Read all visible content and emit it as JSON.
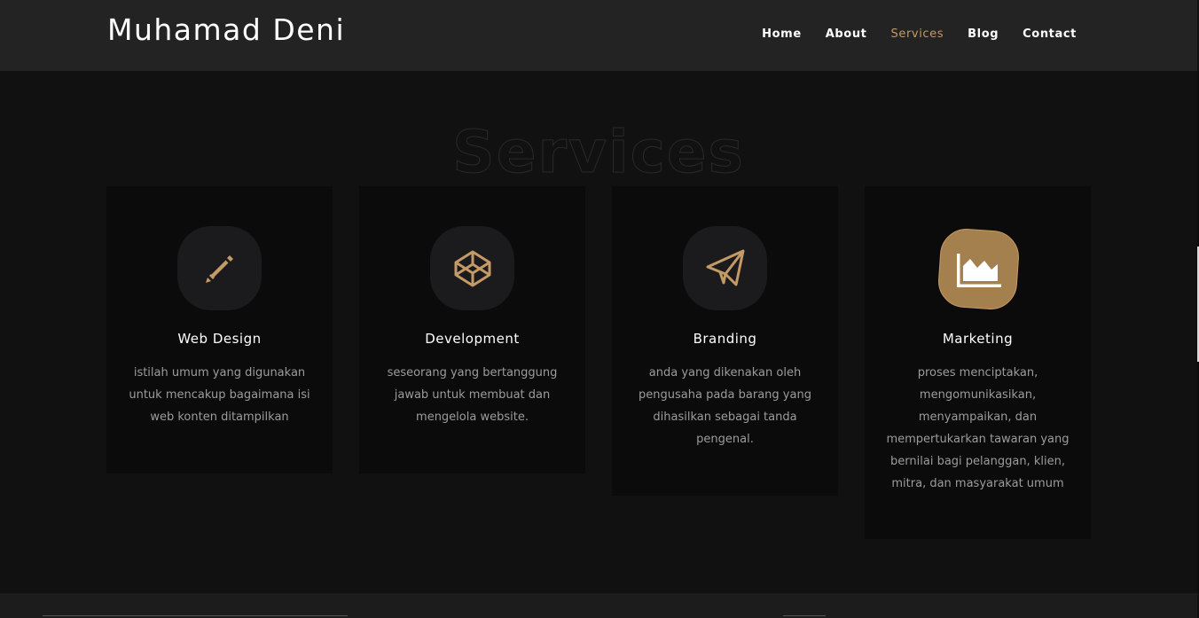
{
  "header": {
    "brand": "Muhamad Deni",
    "nav": [
      {
        "label": "Home",
        "active": false
      },
      {
        "label": "About",
        "active": false
      },
      {
        "label": "Services",
        "active": true
      },
      {
        "label": "Blog",
        "active": false
      },
      {
        "label": "Contact",
        "active": false
      }
    ]
  },
  "section": {
    "title": "Services"
  },
  "services": [
    {
      "icon": "pencil-icon",
      "title": "Web Design",
      "text": "istilah umum yang digunakan untuk mencakup bagaimana isi web konten ditampilkan"
    },
    {
      "icon": "codepen-icon",
      "title": "Development",
      "text": "seseorang yang bertanggung jawab untuk membuat dan mengelola website."
    },
    {
      "icon": "paper-plane-icon",
      "title": "Branding",
      "text": "anda yang dikenakan oleh pengusaha pada barang yang dihasilkan sebagai tanda pengenal."
    },
    {
      "icon": "area-chart-icon",
      "title": "Marketing",
      "text": "proses menciptakan, mengomunikasikan, menyampaikan, dan mempertukarkan tawaran yang bernilai bagi pelanggan, klien, mitra, dan masyarakat umum"
    }
  ],
  "colors": {
    "accent": "#c49a66",
    "background": "#111111",
    "navbar": "#232323",
    "card": "#0b0b0c"
  }
}
